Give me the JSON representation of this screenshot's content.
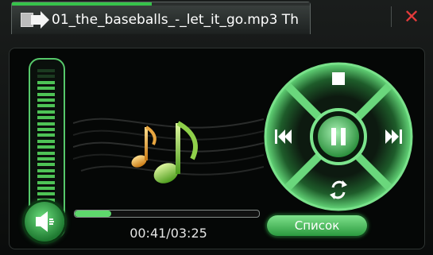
{
  "tab": {
    "title": "01_the_baseballs_-_let_it_go.mp3 Th",
    "progress": 0.47
  },
  "window": {
    "close_glyph": "✕"
  },
  "player": {
    "volume_level": 0.92,
    "track_progress": 0.2,
    "time_display": "00:41/03:25"
  },
  "controls": {
    "playlist_label": "Список",
    "icons": [
      "stop-icon",
      "prev-icon",
      "pause-icon",
      "next-icon",
      "repeat-icon",
      "speaker-icon"
    ]
  },
  "colors": {
    "accent_green": "#36c34a",
    "close_red": "#e43b3b"
  }
}
